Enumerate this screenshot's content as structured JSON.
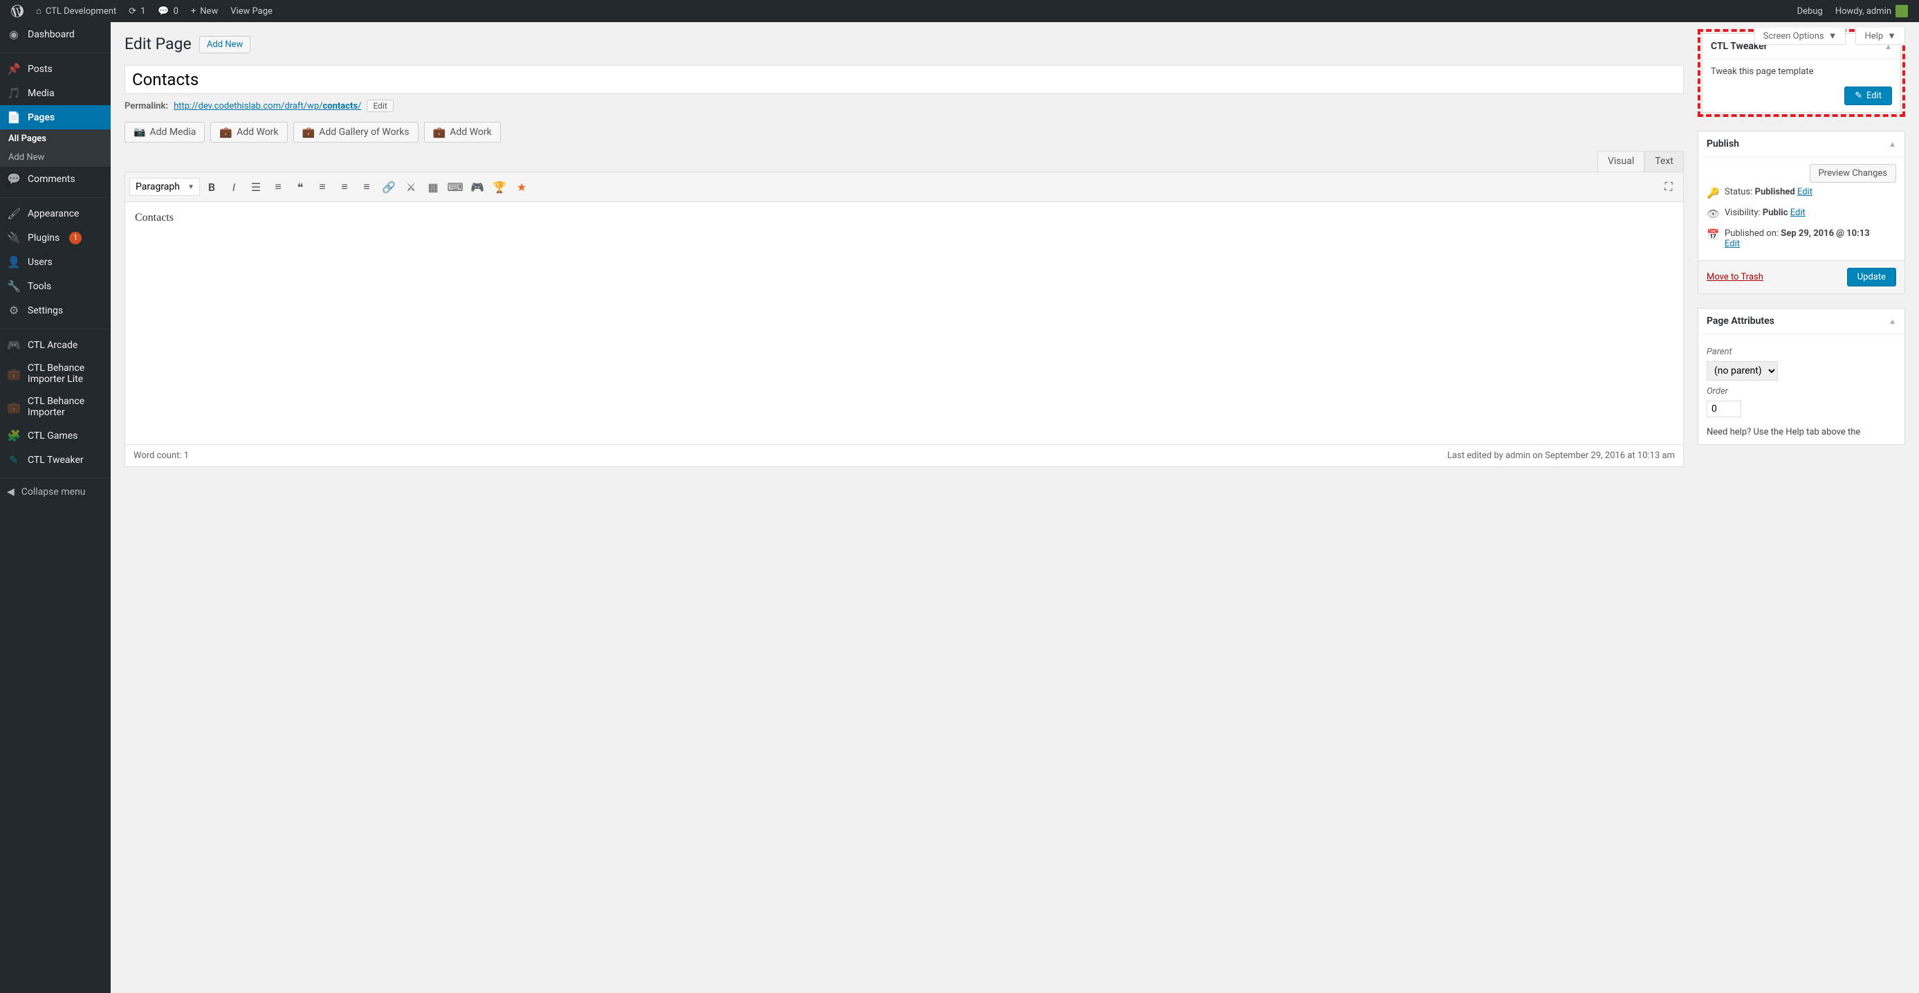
{
  "adminbar": {
    "site": "CTL Development",
    "updates": "1",
    "comments": "0",
    "new": "New",
    "view": "View Page",
    "debug": "Debug",
    "howdy": "Howdy, admin"
  },
  "sidebar": {
    "dashboard": "Dashboard",
    "posts": "Posts",
    "media": "Media",
    "pages": "Pages",
    "all_pages": "All Pages",
    "add_new": "Add New",
    "comments": "Comments",
    "appearance": "Appearance",
    "plugins": "Plugins",
    "plugins_count": "1",
    "users": "Users",
    "tools": "Tools",
    "settings": "Settings",
    "ctl_arcade": "CTL Arcade",
    "ctl_behance_lite": "CTL Behance Importer Lite",
    "ctl_behance": "CTL Behance Importer",
    "ctl_games": "CTL Games",
    "ctl_tweaker": "CTL Tweaker",
    "collapse": "Collapse menu"
  },
  "topTabs": {
    "screen": "Screen Options",
    "help": "Help"
  },
  "heading": "Edit Page",
  "addNew": "Add New",
  "titleValue": "Contacts",
  "permalink": {
    "label": "Permalink:",
    "base": "http://dev.codethislab.com/draft/wp/",
    "slug": "contacts",
    "trail": "/",
    "edit": "Edit"
  },
  "mediaRow": {
    "addMedia": "Add Media",
    "addWork": "Add Work",
    "addGallery": "Add Gallery of Works",
    "addWork2": "Add Work"
  },
  "editorTabs": {
    "visual": "Visual",
    "text": "Text"
  },
  "toolbar": {
    "format": "Paragraph"
  },
  "editorContent": "Contacts",
  "editorFooter": {
    "wordcount": "Word count: 1",
    "lastEdited": "Last edited by admin on September 29, 2016 at 10:13 am"
  },
  "tweaker": {
    "title": "CTL Tweaker",
    "text": "Tweak this page template",
    "edit": "Edit"
  },
  "publish": {
    "title": "Publish",
    "preview": "Preview Changes",
    "status_label": "Status:",
    "status_value": "Published",
    "visibility_label": "Visibility:",
    "visibility_value": "Public",
    "published_label": "Published on:",
    "published_value": "Sep 29, 2016 @ 10:13",
    "edit": "Edit",
    "trash": "Move to Trash",
    "update": "Update"
  },
  "attributes": {
    "title": "Page Attributes",
    "parent_label": "Parent",
    "parent_value": "(no parent)",
    "order_label": "Order",
    "order_value": "0",
    "help": "Need help? Use the Help tab above the"
  }
}
